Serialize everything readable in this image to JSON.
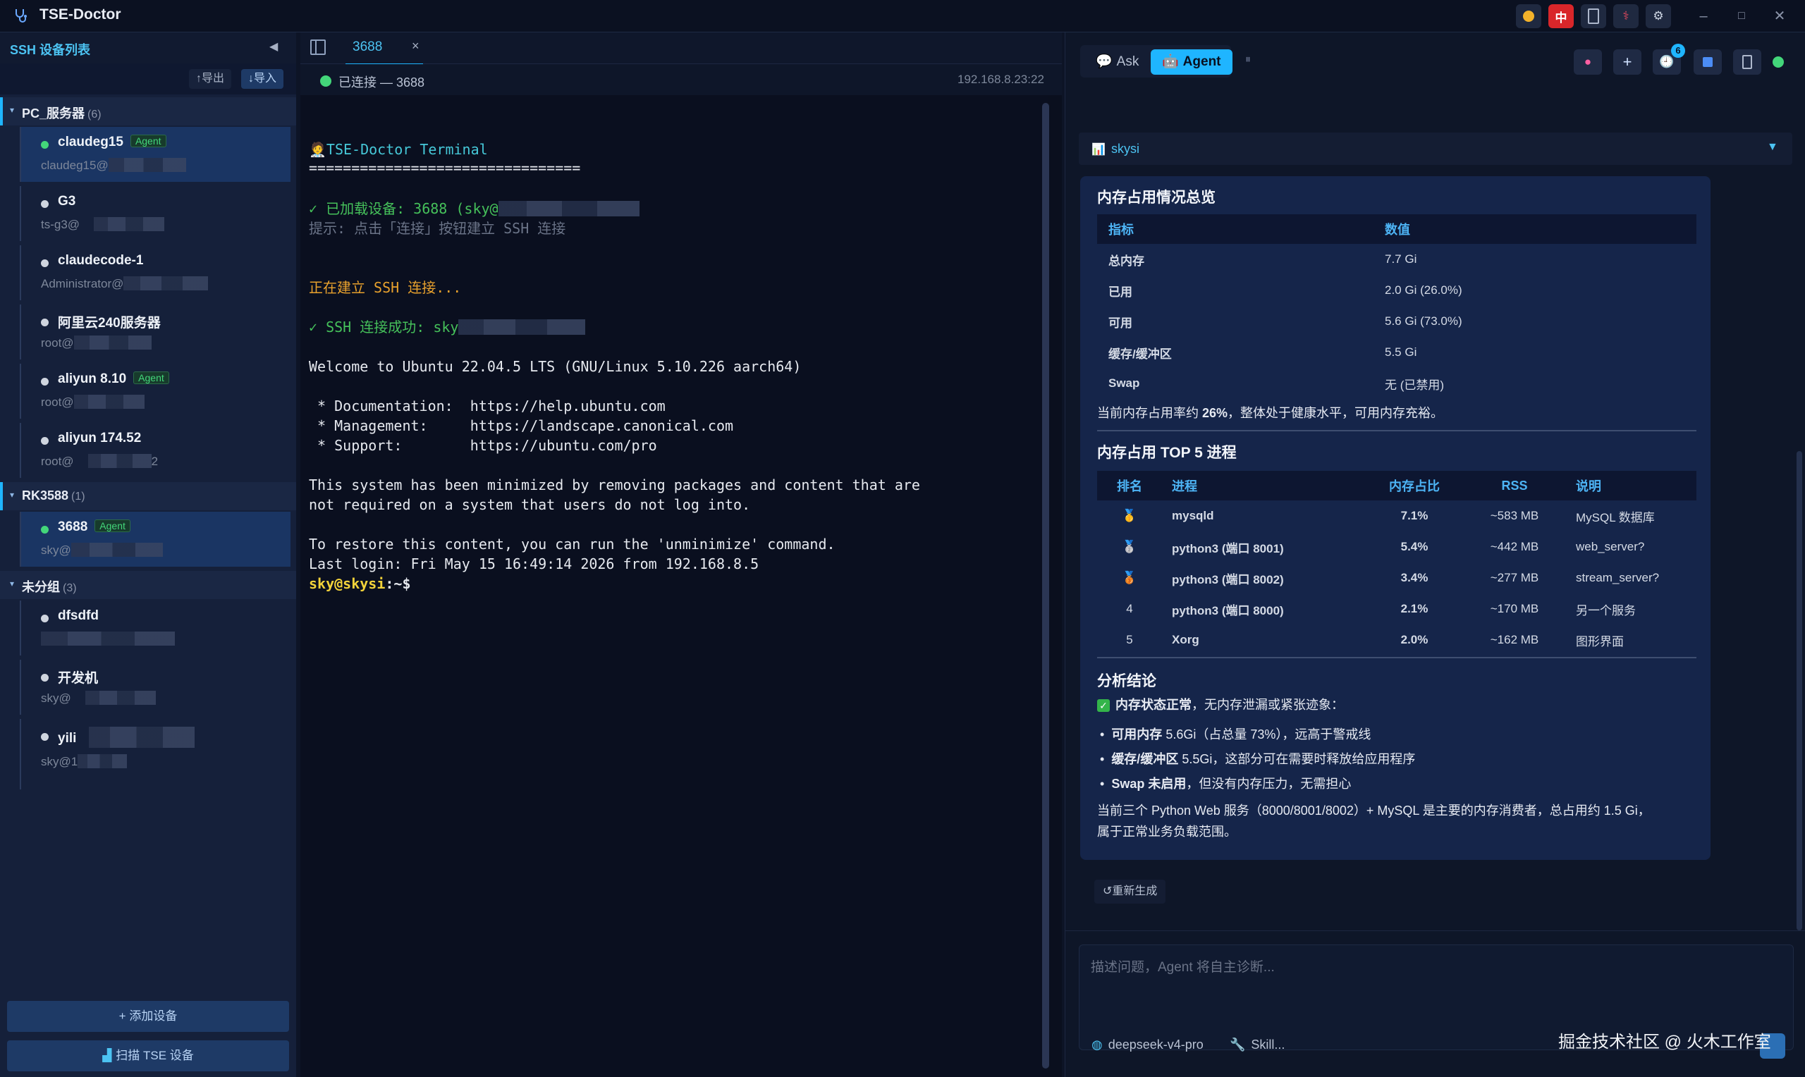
{
  "app": {
    "title": "TSE-Doctor"
  },
  "titlebar": {
    "lang_label": "中",
    "controls": {
      "minimize": "–",
      "maximize": "□",
      "close": "✕"
    }
  },
  "sidebar": {
    "title": "SSH 设备列表",
    "collapse_icon": "◀",
    "export_label": "↑导出",
    "import_label": "↓导入",
    "groups": [
      {
        "name": "PC_服务器",
        "count": "(6)",
        "devices": [
          {
            "name": "claudeg15",
            "agent": "Agent",
            "sub": "claudeg15@",
            "status": "online"
          },
          {
            "name": "G3",
            "agent": "",
            "sub": "ts-g3@",
            "status": "offline"
          },
          {
            "name": "claudecode-1",
            "agent": "",
            "sub": "Administrator@",
            "status": "offline"
          },
          {
            "name": "阿里云240服务器",
            "agent": "",
            "sub": "root@",
            "status": "offline"
          },
          {
            "name": "aliyun 8.10",
            "agent": "Agent",
            "sub": "root@",
            "status": "offline"
          },
          {
            "name": "aliyun 174.52",
            "agent": "",
            "sub": "root@",
            "sub_tail": "2",
            "status": "offline"
          }
        ]
      },
      {
        "name": "RK3588",
        "count": "(1)",
        "devices": [
          {
            "name": "3688",
            "agent": "Agent",
            "sub": "sky@",
            "status": "online"
          }
        ]
      },
      {
        "name": "未分组",
        "count": "(3)",
        "devices": [
          {
            "name": "dfsdfd",
            "agent": "",
            "sub": "",
            "status": "offline"
          },
          {
            "name": "开发机",
            "agent": "",
            "sub": "sky@",
            "status": "offline"
          },
          {
            "name": "yili",
            "agent": "",
            "sub": "sky@1",
            "status": "offline"
          }
        ]
      }
    ],
    "add_device": "+ 添加设备",
    "scan_device": "扫描 TSE 设备"
  },
  "terminal": {
    "tab_label": "3688",
    "tab_close": "×",
    "status": "已连接 — 3688",
    "address": "192.168.8.23:22",
    "lines": {
      "l1": "🧑‍⚕️TSE-Doctor Terminal",
      "l2": "================================",
      "l3": "✓ 已加载设备: 3688 (sky@",
      "l4": "提示: 点击「连接」按钮建立 SSH 连接",
      "l5": "正在建立 SSH 连接...",
      "l6": "✓ SSH 连接成功: sky",
      "l7": "Welcome to Ubuntu 22.04.5 LTS (GNU/Linux 5.10.226 aarch64)",
      "l8": " * Documentation:  https://help.ubuntu.com",
      "l9": " * Management:     https://landscape.canonical.com",
      "l10": " * Support:        https://ubuntu.com/pro",
      "l11": "This system has been minimized by removing packages and content that are",
      "l12": "not required on a system that users do not log into.",
      "l13": "To restore this content, you can run the 'unminimize' command.",
      "l14": "Last login: Fri May 15 16:49:14 2026 from 192.168.8.5",
      "prompt_user": "sky@skysi",
      "prompt_path": ":~$"
    }
  },
  "assistant": {
    "mode_ask": "Ask",
    "mode_agent": "Agent",
    "badge_count": "6",
    "conversation_title": "skysi",
    "card": {
      "mem_title": "内存占用情况总览",
      "mem_headers": [
        "指标",
        "数值"
      ],
      "mem_rows": [
        [
          "总内存",
          "7.7 Gi"
        ],
        [
          "已用",
          "2.0 Gi (26.0%)"
        ],
        [
          "可用",
          "5.6 Gi (73.0%)"
        ],
        [
          "缓存/缓冲区",
          "5.5 Gi"
        ],
        [
          "Swap",
          "无 (已禁用)"
        ]
      ],
      "mem_summary_a": "当前内存占用率约 ",
      "mem_summary_b": "26%",
      "mem_summary_c": "，整体处于健康水平，可用内存充裕。",
      "top_title": "内存占用 TOP 5 进程",
      "top_headers": [
        "排名",
        "进程",
        "内存占比",
        "RSS",
        "说明"
      ],
      "top_rows": [
        [
          "🥇",
          "mysqld",
          "7.1%",
          "~583 MB",
          "MySQL 数据库"
        ],
        [
          "🥈",
          "python3 (端口 8001)",
          "5.4%",
          "~442 MB",
          "web_server?"
        ],
        [
          "🥉",
          "python3 (端口 8002)",
          "3.4%",
          "~277 MB",
          "stream_server?"
        ],
        [
          "4",
          "python3 (端口 8000)",
          "2.1%",
          "~170 MB",
          "另一个服务"
        ],
        [
          "5",
          "Xorg",
          "2.0%",
          "~162 MB",
          "图形界面"
        ]
      ],
      "conclusion_title": "分析结论",
      "status_bold": "内存状态正常",
      "status_rest": "，无内存泄漏或紧张迹象：",
      "bullets": [
        {
          "bold": "可用内存",
          "rest": " 5.6Gi（占总量 73%），远高于警戒线"
        },
        {
          "bold": "缓存/缓冲区",
          "rest": " 5.5Gi，这部分可在需要时释放给应用程序"
        },
        {
          "bold": "Swap 未启用",
          "rest": "，但没有内存压力，无需担心"
        }
      ],
      "final_1": "当前三个 Python Web 服务（8000/8001/8002）+ MySQL 是主要的内存消费者，总占用约 1.5 Gi，",
      "final_2": "属于正常业务负载范围。"
    },
    "regenerate": "↺重新生成",
    "input_placeholder": "描述问题，Agent 将自主诊断...",
    "model": "deepseek-v4-pro",
    "skill": "Skill..."
  },
  "watermark": "掘金技术社区 @ 火木工作室",
  "colors": {
    "accent": "#1fb5ff",
    "online": "#43d67a",
    "offline": "#cfd5df",
    "prompt": "#f2d23a",
    "success": "#45c05a",
    "warning": "#e8a12d"
  }
}
